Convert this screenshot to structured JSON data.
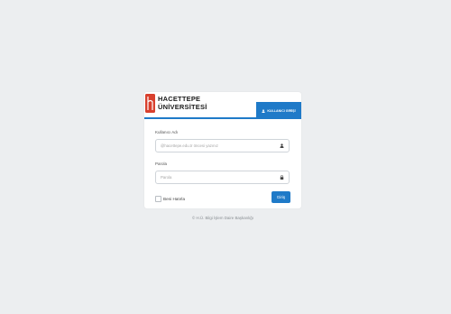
{
  "brand": {
    "line1": "HACETTEPE",
    "line2": "ÜNİVERSİTESİ",
    "logo_color": "#d8402e"
  },
  "header": {
    "login_tab_label": "KULLANICI GİRİŞİ",
    "accent_color": "#1f7ac8"
  },
  "form": {
    "username_label": "Kullanıcı Adı",
    "username_placeholder": "@hacettepe.edu.tr öncesi yazınız",
    "username_icon": "user-icon",
    "password_label": "Parola",
    "password_placeholder": "Parola",
    "password_icon": "lock-icon",
    "remember_label": "Beni Hatırla",
    "submit_label": "Giriş"
  },
  "footer": {
    "text": "© H.Ü. Bilgi İşlem Daire Başkanlığı"
  }
}
